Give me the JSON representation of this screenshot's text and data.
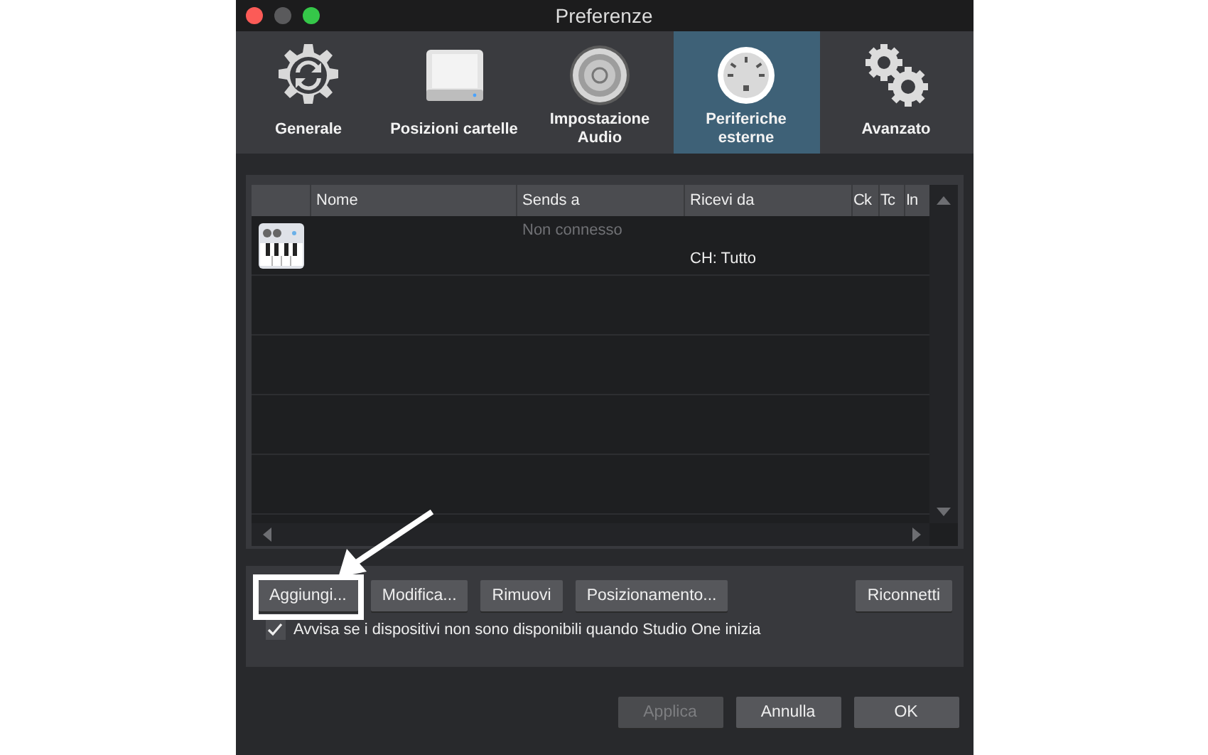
{
  "window": {
    "title": "Preferenze",
    "traffic_lights": [
      {
        "color": "#fc5b57"
      },
      {
        "color": "#5a5a5c"
      },
      {
        "color": "#35c749"
      }
    ]
  },
  "tabs": [
    {
      "label": "Generale",
      "kind": "sync-gear",
      "selected": false
    },
    {
      "label": "Posizioni cartelle",
      "kind": "drive",
      "selected": false
    },
    {
      "label": "Impostazione Audio",
      "kind": "speaker",
      "selected": false
    },
    {
      "label": "Periferiche esterne",
      "kind": "midi",
      "selected": true
    },
    {
      "label": "Avanzato",
      "kind": "gears",
      "selected": false
    }
  ],
  "table": {
    "columns": [
      "",
      "Nome",
      "Sends a",
      "Ricevi da",
      "Ck",
      "Tc",
      "In"
    ],
    "rows": [
      {
        "kind": "keyboard",
        "sends_to": "Non connesso",
        "receives_from": "CH: Tutto"
      }
    ]
  },
  "device_buttons": [
    {
      "label": "Aggiungi...",
      "highlighted": true
    },
    {
      "label": "Modifica...",
      "highlighted": false
    },
    {
      "label": "Rimuovi",
      "highlighted": false
    },
    {
      "label": "Posizionamento...",
      "highlighted": false
    },
    {
      "label": "Riconnetti",
      "highlighted": false
    }
  ],
  "warn_checkbox": {
    "label": "Avvisa se i dispositivi non sono disponibili quando Studio One inizia",
    "checked": true
  },
  "dialog_buttons": [
    {
      "label": "Applica",
      "disabled": true
    },
    {
      "label": "Annulla",
      "disabled": false
    },
    {
      "label": "OK",
      "disabled": false
    }
  ]
}
